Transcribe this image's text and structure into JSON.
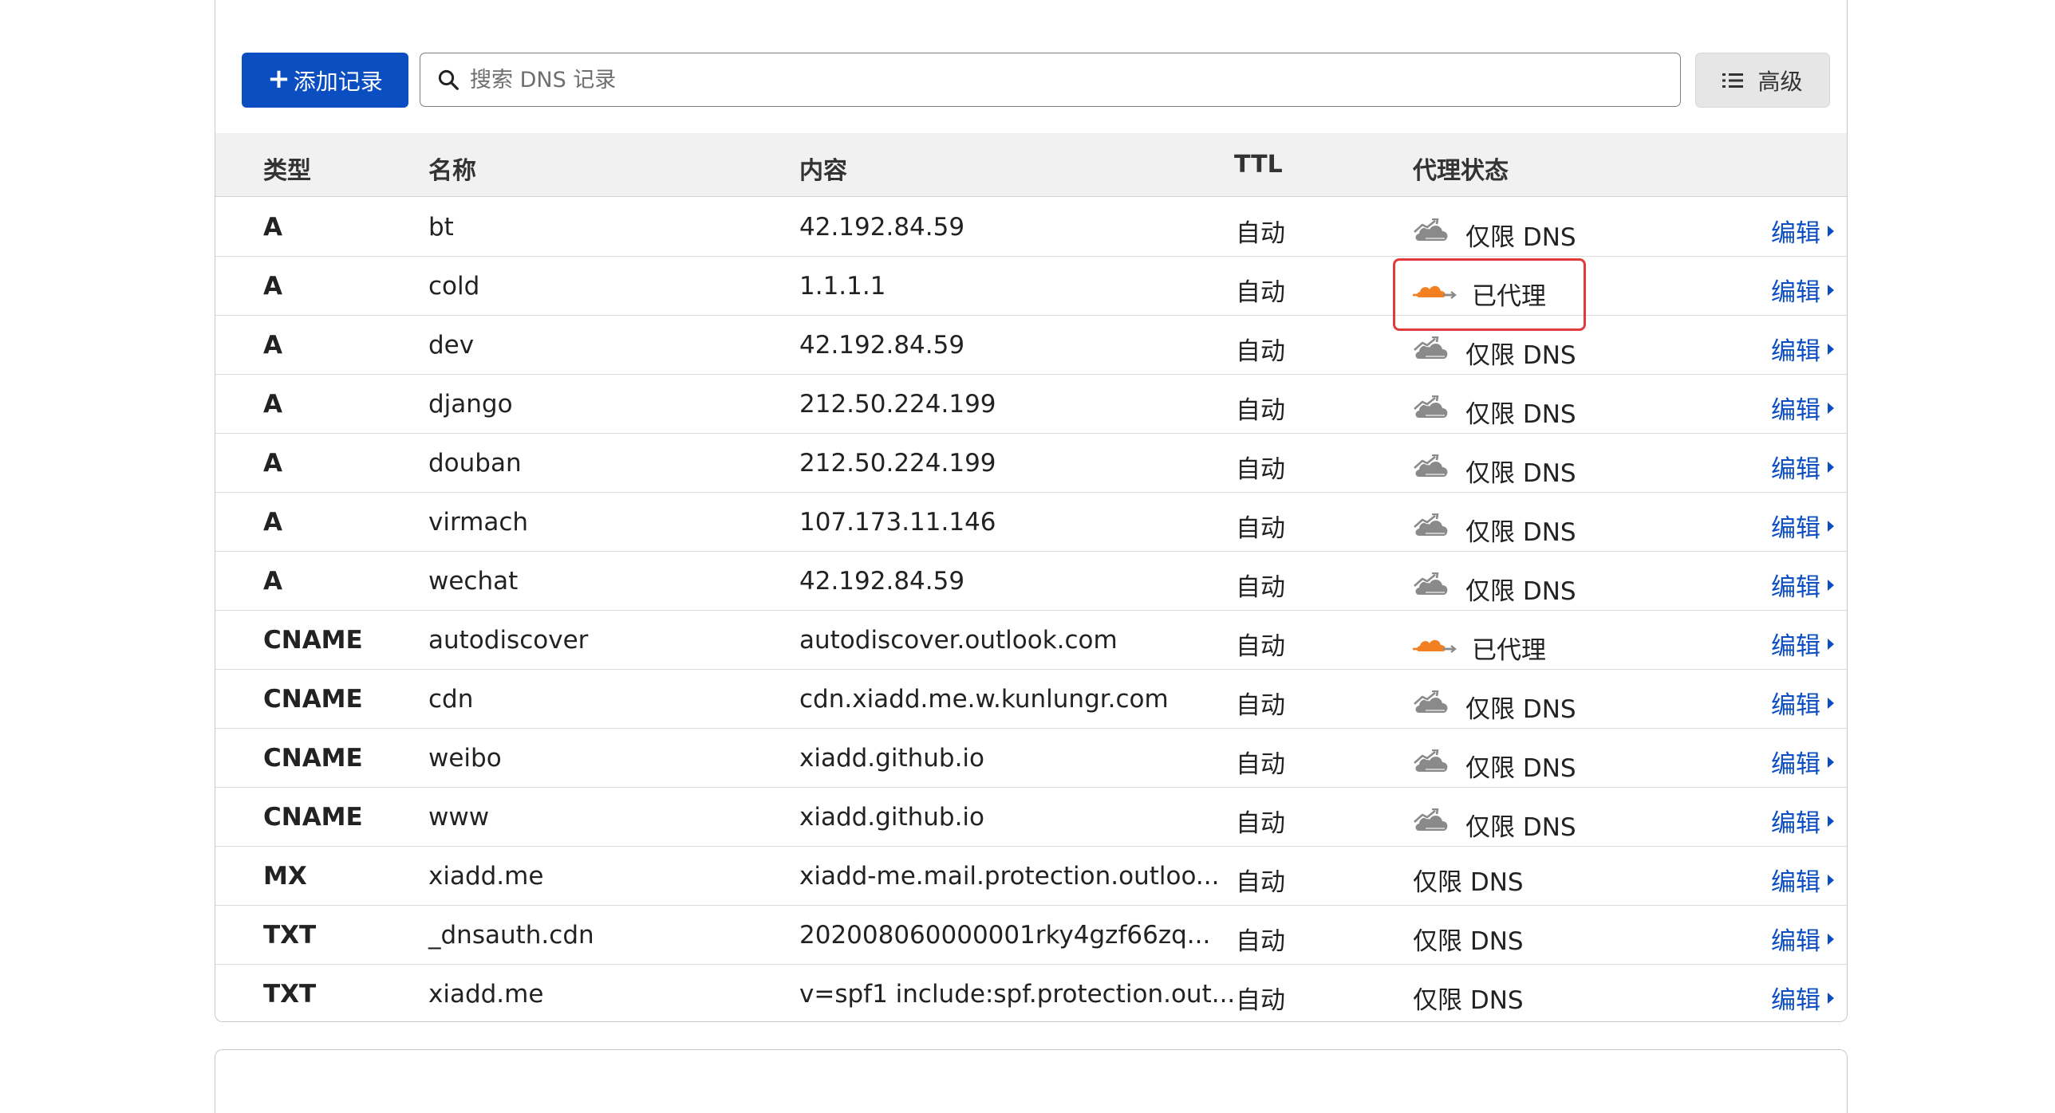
{
  "toolbar": {
    "add_label": "添加记录",
    "search_placeholder": "搜索 DNS 记录",
    "advanced_label": "高级"
  },
  "table": {
    "headers": {
      "type": "类型",
      "name": "名称",
      "content": "内容",
      "ttl": "TTL",
      "proxy": "代理状态"
    },
    "edit_label": "编辑",
    "rows": [
      {
        "type": "A",
        "name": "bt",
        "content": "42.192.84.59",
        "ttl": "自动",
        "proxy": "仅限 DNS",
        "icon": "dns-only-cloud-icon"
      },
      {
        "type": "A",
        "name": "cold",
        "content": "1.1.1.1",
        "ttl": "自动",
        "proxy": "已代理",
        "icon": "proxied-cloud-icon"
      },
      {
        "type": "A",
        "name": "dev",
        "content": "42.192.84.59",
        "ttl": "自动",
        "proxy": "仅限 DNS",
        "icon": "dns-only-cloud-icon"
      },
      {
        "type": "A",
        "name": "django",
        "content": "212.50.224.199",
        "ttl": "自动",
        "proxy": "仅限 DNS",
        "icon": "dns-only-cloud-icon"
      },
      {
        "type": "A",
        "name": "douban",
        "content": "212.50.224.199",
        "ttl": "自动",
        "proxy": "仅限 DNS",
        "icon": "dns-only-cloud-icon"
      },
      {
        "type": "A",
        "name": "virmach",
        "content": "107.173.11.146",
        "ttl": "自动",
        "proxy": "仅限 DNS",
        "icon": "dns-only-cloud-icon"
      },
      {
        "type": "A",
        "name": "wechat",
        "content": "42.192.84.59",
        "ttl": "自动",
        "proxy": "仅限 DNS",
        "icon": "dns-only-cloud-icon"
      },
      {
        "type": "CNAME",
        "name": "autodiscover",
        "content": "autodiscover.outlook.com",
        "ttl": "自动",
        "proxy": "已代理",
        "icon": "proxied-cloud-icon"
      },
      {
        "type": "CNAME",
        "name": "cdn",
        "content": "cdn.xiadd.me.w.kunlungr.com",
        "ttl": "自动",
        "proxy": "仅限 DNS",
        "icon": "dns-only-cloud-icon"
      },
      {
        "type": "CNAME",
        "name": "weibo",
        "content": "xiadd.github.io",
        "ttl": "自动",
        "proxy": "仅限 DNS",
        "icon": "dns-only-cloud-icon"
      },
      {
        "type": "CNAME",
        "name": "www",
        "content": "xiadd.github.io",
        "ttl": "自动",
        "proxy": "仅限 DNS",
        "icon": "dns-only-cloud-icon"
      },
      {
        "type": "MX",
        "name": "xiadd.me",
        "content": "xiadd-me.mail.protection.outloo...",
        "ttl": "自动",
        "proxy": "仅限 DNS",
        "icon": ""
      },
      {
        "type": "TXT",
        "name": "_dnsauth.cdn",
        "content": "202008060000001rky4gzf66zq...",
        "ttl": "自动",
        "proxy": "仅限 DNS",
        "icon": ""
      },
      {
        "type": "TXT",
        "name": "xiadd.me",
        "content": "v=spf1 include:spf.protection.out...",
        "ttl": "自动",
        "proxy": "仅限 DNS",
        "icon": ""
      }
    ]
  },
  "colors": {
    "primary": "#0b4ec2",
    "proxied_orange": "#f38020",
    "dns_gray": "#8a8a8a",
    "highlight_red": "#e23b3b"
  }
}
